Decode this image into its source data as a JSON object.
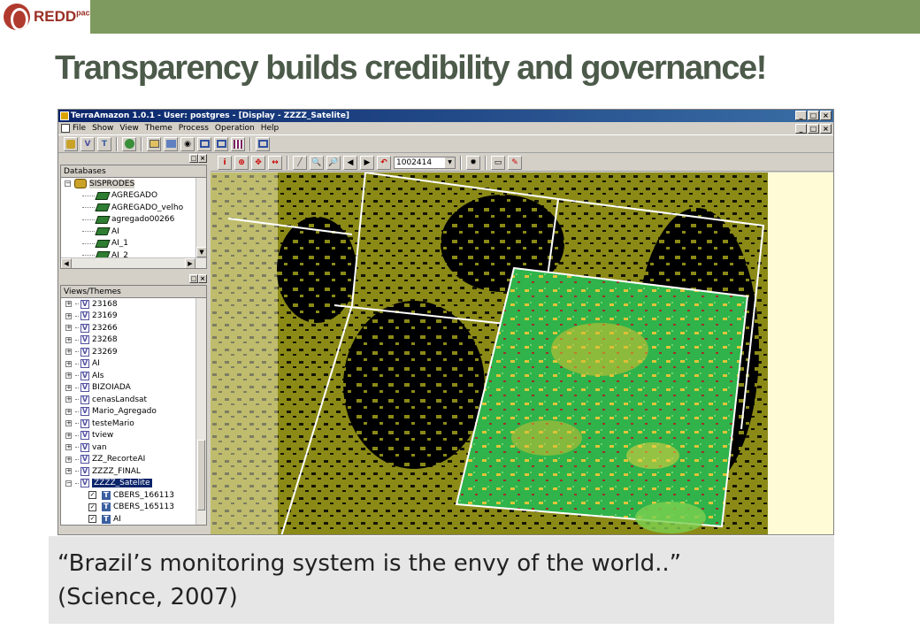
{
  "slide": {
    "logo_text": "REDD",
    "logo_sup": "pac",
    "title": "Transparency builds credibility and governance!",
    "quote_line1": "“Brazil’s monitoring system is the envy of the world..”",
    "quote_line2": "(Science, 2007)"
  },
  "app": {
    "window_title": "TerraAmazon 1.0.1 - User: postgres - [Display - ZZZZ_Satelite]",
    "menus": [
      "File",
      "Show",
      "View",
      "Theme",
      "Process",
      "Operation",
      "Help"
    ],
    "window_buttons": [
      "_",
      "□",
      "×"
    ],
    "doc_buttons": [
      "_",
      "□",
      "×"
    ],
    "scale_value": "1002414"
  },
  "databases": {
    "label": "Databases",
    "root": "SISPRODES",
    "layers": [
      "AGREGADO",
      "AGREGADO_velho",
      "agregado00266",
      "AI",
      "AI_1",
      "AI_2"
    ]
  },
  "views": {
    "label": "Views/Themes",
    "items": [
      "23168",
      "23169",
      "23266",
      "23268",
      "23269",
      "AI",
      "AIs",
      "BIZOIADA",
      "cenasLandsat",
      "Mario_Agregado",
      "testeMario",
      "tview",
      "van",
      "ZZ_RecorteAI",
      "ZZZZ_FINAL",
      "ZZZZ_Satelite"
    ],
    "selected": "ZZZZ_Satelite",
    "themes": [
      "CBERS_166113",
      "CBERS_165113",
      "AI"
    ]
  },
  "colors": {
    "topbar": "#7f9a5e",
    "title": "#4c5a4a",
    "deforest_olive": "#8b8a17",
    "satellite_green": "#2fb34a",
    "map_background": "#fffbd6"
  }
}
